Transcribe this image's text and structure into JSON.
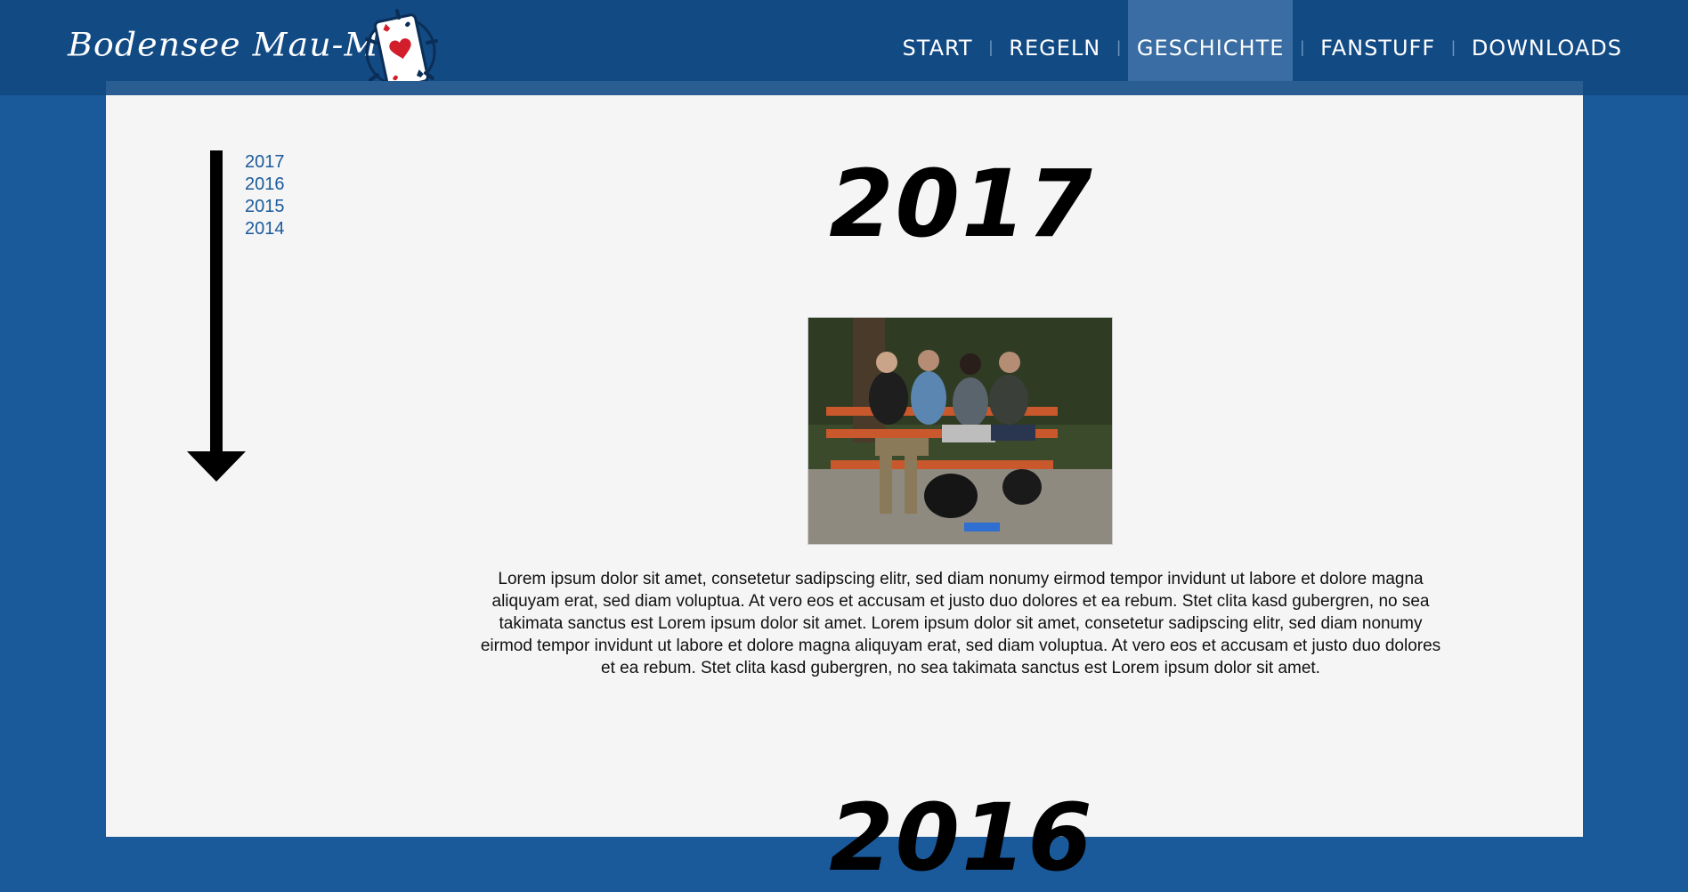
{
  "brand": {
    "title": "Bodensee Mau-Mau"
  },
  "nav": {
    "items": [
      {
        "label": "START"
      },
      {
        "label": "REGELN"
      },
      {
        "label": "GESCHICHTE"
      },
      {
        "label": "FANSTUFF"
      },
      {
        "label": "DOWNLOADS"
      }
    ],
    "separator": "|",
    "active_index": 2
  },
  "timeline": {
    "years": [
      "2017",
      "2016",
      "2015",
      "2014"
    ]
  },
  "sections": [
    {
      "year": "2017",
      "paragraph": "Lorem ipsum dolor sit amet, consetetur sadipscing elitr, sed diam nonumy eirmod tempor invidunt ut labore et dolore magna aliquyam erat, sed diam voluptua. At vero eos et accusam et justo duo dolores et ea rebum. Stet clita kasd gubergren, no sea takimata sanctus est Lorem ipsum dolor sit amet. Lorem ipsum dolor sit amet, consetetur sadipscing elitr, sed diam nonumy eirmod tempor invidunt ut labore et dolore magna aliquyam erat, sed diam voluptua. At vero eos et accusam et justo duo dolores et ea rebum. Stet clita kasd gubergren, no sea takimata sanctus est Lorem ipsum dolor sit amet."
    },
    {
      "year": "2016"
    }
  ],
  "colors": {
    "header": "#124a84",
    "page_bg": "#1a5a9b",
    "content_bg": "#f5f5f5",
    "active_nav": "#3a6da3",
    "link": "#1a5a9b"
  },
  "icons": {
    "logo": "playing-card-ace-of-hearts-icon",
    "timeline": "arrow-down-icon"
  }
}
